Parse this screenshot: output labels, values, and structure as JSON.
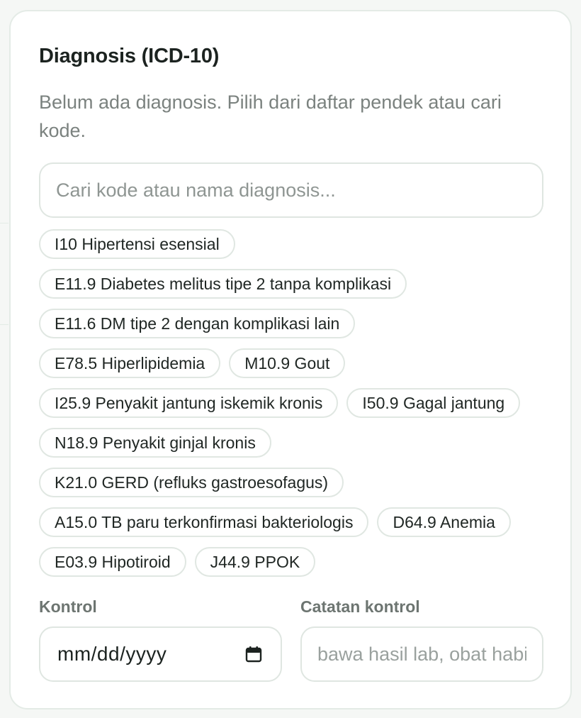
{
  "diagnosis": {
    "title": "Diagnosis (ICD-10)",
    "empty_message": "Belum ada diagnosis. Pilih dari daftar pendek atau cari kode.",
    "search_placeholder": "Cari kode atau nama diagnosis...",
    "chips": [
      "I10 Hipertensi esensial",
      "E11.9 Diabetes melitus tipe 2 tanpa komplikasi",
      "E11.6 DM tipe 2 dengan komplikasi lain",
      "E78.5 Hiperlipidemia",
      "M10.9 Gout",
      "I25.9 Penyakit jantung iskemik kronis",
      "I50.9 Gagal jantung",
      "N18.9 Penyakit ginjal kronis",
      "K21.0 GERD (refluks gastroesofagus)",
      "A15.0 TB paru terkonfirmasi bakteriologis",
      "D64.9 Anemia",
      "E03.9 Hipotiroid",
      "J44.9 PPOK"
    ]
  },
  "kontrol": {
    "label": "Kontrol",
    "date_placeholder": "mm/dd/yyyy",
    "calendar_icon": "calendar-icon"
  },
  "catatan": {
    "label": "Catatan kontrol",
    "placeholder": "bawa hasil lab, obat habis"
  }
}
